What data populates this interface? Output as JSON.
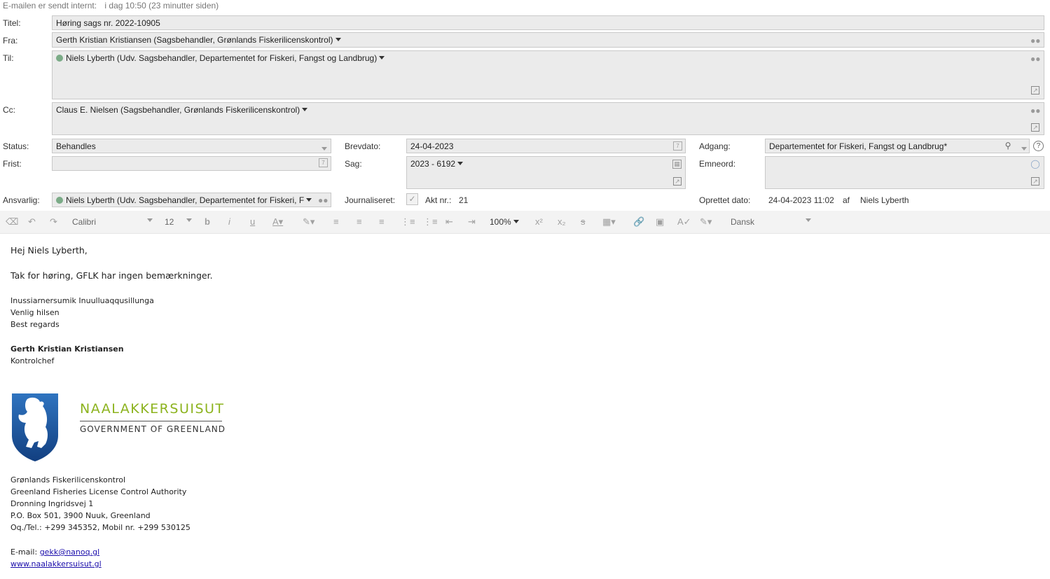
{
  "info": {
    "sent_label": "E-mailen er sendt internt:",
    "sent_time": "i dag 10:50 (23 minutter siden)"
  },
  "fields": {
    "titel_label": "Titel:",
    "titel_value": "Høring sags nr. 2022-10905",
    "fra_label": "Fra:",
    "fra_value": "Gerth Kristian Kristiansen (Sagsbehandler, Grønlands Fiskerilicenskontrol)",
    "til_label": "Til:",
    "til_value": "Niels Lyberth (Udv. Sagsbehandler, Departementet for Fiskeri, Fangst og Landbrug)",
    "cc_label": "Cc:",
    "cc_value": "Claus  E. Nielsen (Sagsbehandler, Grønlands Fiskerilicenskontrol)",
    "status_label": "Status:",
    "status_value": "Behandles",
    "frist_label": "Frist:",
    "frist_value": "",
    "ansvarlig_label": "Ansvarlig:",
    "ansvarlig_value": "Niels Lyberth (Udv. Sagsbehandler, Departementet for Fiskeri, F",
    "brevdato_label": "Brevdato:",
    "brevdato_value": "24-04-2023",
    "sag_label": "Sag:",
    "sag_value": "2023 - 6192",
    "journaliseret_label": "Journaliseret:",
    "akt_label": "Akt nr.:",
    "akt_value": "21",
    "adgang_label": "Adgang:",
    "adgang_value": "Departementet for Fiskeri, Fangst og Landbrug*",
    "emneord_label": "Emneord:",
    "oprettet_label": "Oprettet dato:",
    "oprettet_value": "24-04-2023 11:02",
    "af_label": "af",
    "oprettet_by": "Niels Lyberth"
  },
  "toolbar": {
    "font": "Calibri",
    "size": "12",
    "zoom": "100%",
    "language": "Dansk"
  },
  "email": {
    "greeting": "Hej Niels Lyberth,",
    "line1": "Tak for høring, GFLK har ingen bemærkninger.",
    "closing1": "Inussiarnersumik Inuulluaqqusillunga",
    "closing2": "Venlig hilsen",
    "closing3": "Best regards",
    "sender_name": "Gerth Kristian Kristiansen",
    "sender_title": "Kontrolchef",
    "logo_line1": "NAALAKKERSUISUT",
    "logo_line2": "GOVERNMENT OF GREENLAND",
    "addr1": "Grønlands Fiskerilicenskontrol",
    "addr2": "Greenland Fisheries License Control Authority",
    "addr3": "Dronning Ingridsvej 1",
    "addr4": "P.O. Box 501, 3900 Nuuk, Greenland",
    "addr5": "Oq./Tel.: +299 345352,  Mobil nr. +299 530125",
    "email_label": "E-mail: ",
    "email_link": "gekk@nanoq.gl",
    "web_link": "www.naalakkersuisut.gl"
  },
  "colors": {
    "field_bg": "#ebebeb",
    "presence_green": "#7bab87",
    "logo_green": "#8cb31e",
    "shield_blue": "#1f5fa8"
  }
}
